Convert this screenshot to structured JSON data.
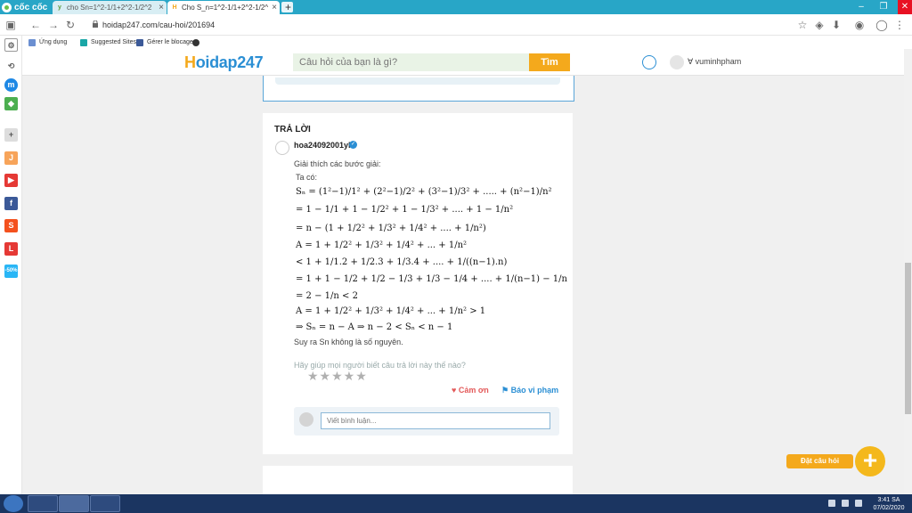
{
  "browser": {
    "brand": "cốc cốc",
    "tabs": [
      {
        "title": "cho Sn=1^2-1/1+2^2-1/2^2",
        "favicon": "y"
      },
      {
        "title": "Cho S_n=1^2-1/1+2^2-1/2^",
        "favicon": "H"
      }
    ],
    "url": "hoidap247.com/cau-hoi/201694",
    "bookmarks": [
      {
        "label": "Ứng dụng",
        "icon": "apps-icon"
      },
      {
        "label": "Suggested Sites",
        "icon": "bing-icon"
      },
      {
        "label": "Gérer le blocage",
        "icon": "facebook-icon"
      }
    ]
  },
  "site": {
    "logo": "oidap247",
    "logo_h": "H",
    "search_placeholder": "Câu hỏi của bạn là gì?",
    "search_button": "Tìm",
    "username": "vuminhpham"
  },
  "answer": {
    "title": "TRẢ LỜI",
    "author": "hoa24092001yl",
    "intro": "Giải thích các bước giải:",
    "ta_co": "Ta có:",
    "lines": [
      "Sₙ = (1²−1)/1² + (2²−1)/2² + (3²−1)/3² + ..... + (n²−1)/n²",
      "= 1 − 1/1 + 1 − 1/2² + 1 − 1/3² + .... + 1 − 1/n²",
      "= n − (1 + 1/2² + 1/3² + 1/4² + .... + 1/n²)",
      "A = 1 + 1/2² + 1/3² + 1/4² + ... + 1/n²",
      "< 1 + 1/1.2 + 1/2.3 + 1/3.4 + .... + 1/((n−1).n)",
      "= 1 + 1 − 1/2 + 1/2 − 1/3 + 1/3 − 1/4 + .... + 1/(n−1) − 1/n",
      "= 2 − 1/n < 2",
      "A = 1 + 1/2² + 1/3² + 1/4² + ... + 1/n² > 1",
      "⇒ Sₙ = n − A ⇒ n − 2 < Sₙ < n − 1"
    ],
    "conclusion": "Suy ra Sn không là số nguyên.",
    "rating_prompt": "Hãy giúp mọi người biết câu trả lời này thế nào?",
    "stars": "★★★★★",
    "thanks": "Cảm ơn",
    "report": "Báo vi phạm",
    "comment_placeholder": "Viết bình luận..."
  },
  "ask_button": "Đặt câu hỏi",
  "clock": {
    "time": "3:41 SA",
    "date": "07/02/2020"
  },
  "sidebar_badge": "-50%"
}
